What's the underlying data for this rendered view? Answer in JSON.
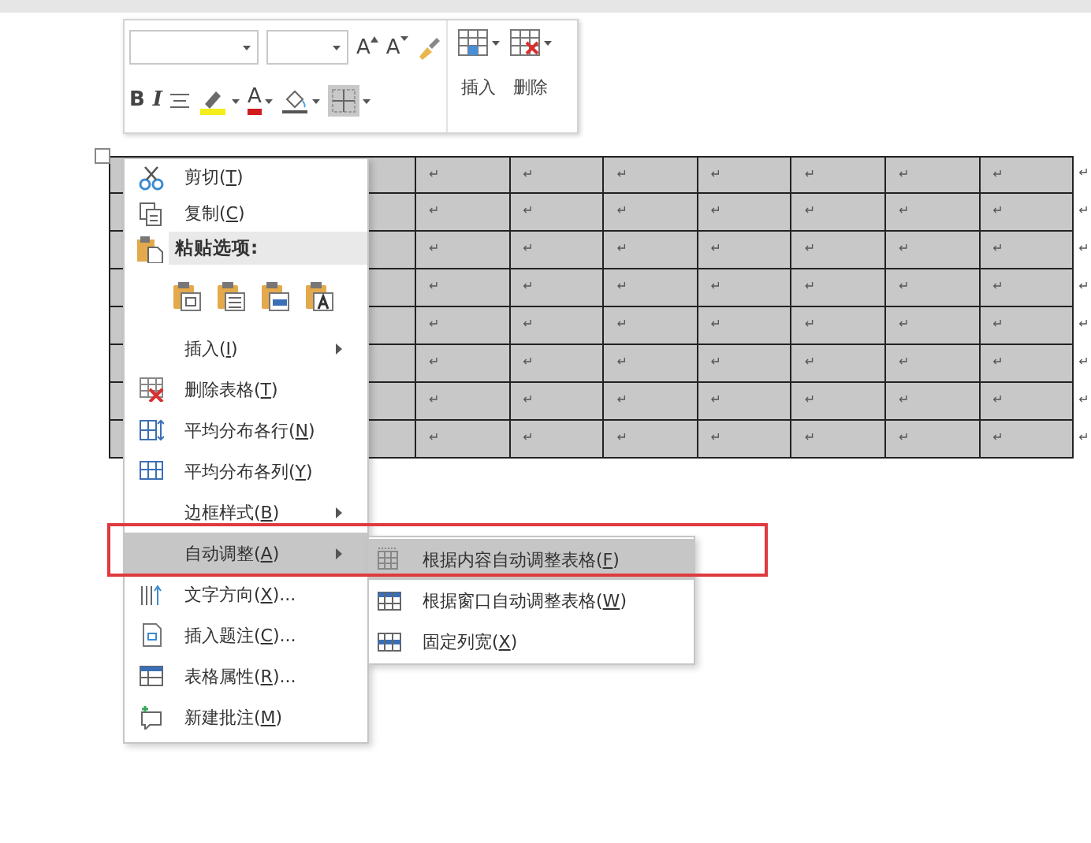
{
  "mini_toolbar": {
    "grow_font": "A",
    "shrink_font": "A",
    "bold": "B",
    "italic": "I",
    "font_color": "A",
    "insert_label": "插入",
    "delete_label": "删除",
    "borders_on": true
  },
  "table": {
    "rows": [
      {
        "cells": [
          "↵",
          "↵",
          "↵",
          "↵",
          "↵",
          "↵",
          "↵"
        ],
        "end_mark": "↵"
      },
      {
        "cells": [
          "↵",
          "↵",
          "↵",
          "↵",
          "↵",
          "↵",
          "↵"
        ],
        "end_mark": "↵"
      },
      {
        "cells": [
          "↵",
          "↵",
          "↵",
          "↵",
          "↵",
          "↵",
          "↵"
        ],
        "end_mark": "↵"
      },
      {
        "cells": [
          "↵",
          "↵",
          "↵",
          "↵",
          "↵",
          "↵",
          "↵"
        ],
        "end_mark": "↵"
      },
      {
        "cells": [
          "↵",
          "↵",
          "↵",
          "↵",
          "↵",
          "↵",
          "↵"
        ],
        "end_mark": "↵"
      },
      {
        "cells": [
          "↵",
          "↵",
          "↵",
          "↵",
          "↵",
          "↵",
          "↵"
        ],
        "end_mark": "↵"
      },
      {
        "cells": [
          "↵",
          "↵",
          "↵",
          "↵",
          "↵",
          "↵",
          "↵"
        ],
        "end_mark": "↵"
      },
      {
        "cells": [
          "↵",
          "↵",
          "↵",
          "↵",
          "↵",
          "↵",
          "↵"
        ],
        "end_mark": "↵"
      }
    ]
  },
  "context_menu": {
    "items": [
      {
        "kind": "item",
        "label": "剪切(T)",
        "submenu": false,
        "selected": false
      },
      {
        "kind": "item",
        "label": "复制(C)",
        "submenu": false,
        "selected": false
      },
      {
        "kind": "header",
        "label": "粘贴选项:"
      },
      {
        "kind": "paste_options"
      },
      {
        "kind": "item",
        "label": "插入(I)",
        "submenu": true,
        "selected": false
      },
      {
        "kind": "item",
        "label": "删除表格(T)",
        "submenu": false,
        "selected": false
      },
      {
        "kind": "item",
        "label": "平均分布各行(N)",
        "submenu": false,
        "selected": false
      },
      {
        "kind": "item",
        "label": "平均分布各列(Y)",
        "submenu": false,
        "selected": false
      },
      {
        "kind": "item",
        "label": "边框样式(B)",
        "submenu": true,
        "selected": false
      },
      {
        "kind": "item",
        "label": "自动调整(A)",
        "submenu": true,
        "selected": true
      },
      {
        "kind": "item",
        "label": "文字方向(X)...",
        "submenu": false,
        "selected": false
      },
      {
        "kind": "item",
        "label": "插入题注(C)...",
        "submenu": false,
        "selected": false
      },
      {
        "kind": "item",
        "label": "表格属性(R)...",
        "submenu": false,
        "selected": false
      },
      {
        "kind": "item",
        "label": "新建批注(M)",
        "submenu": false,
        "selected": false
      }
    ]
  },
  "submenu": {
    "items": [
      {
        "label": "根据内容自动调整表格(F)",
        "selected": true
      },
      {
        "label": "根据窗口自动调整表格(W)",
        "selected": false
      },
      {
        "label": "固定列宽(X)",
        "selected": false
      }
    ]
  }
}
